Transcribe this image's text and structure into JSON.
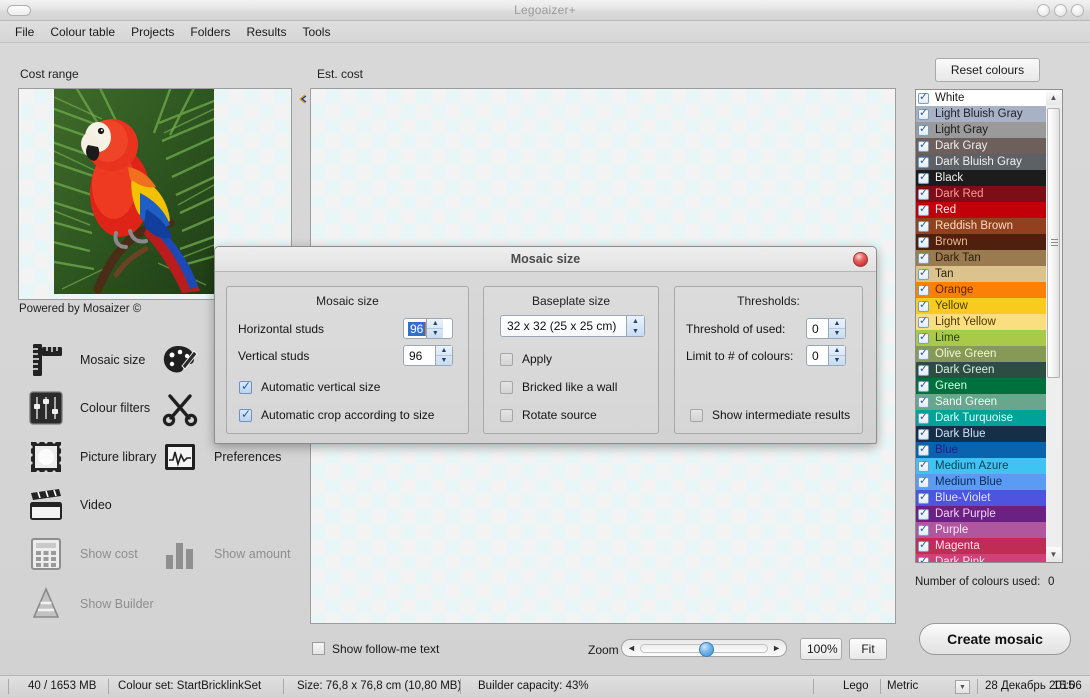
{
  "window": {
    "title": "Legoaizer+",
    "controls": [
      "minimize",
      "maximize",
      "close"
    ]
  },
  "menubar": {
    "items": [
      "File",
      "Colour table",
      "Projects",
      "Folders",
      "Results",
      "Tools"
    ]
  },
  "panels": {
    "cost_range_label": "Cost range",
    "est_cost_label": "Est. cost",
    "powered_by": "Powered by Mosaizer ©",
    "collapse_arrow": "«"
  },
  "tools": [
    {
      "label": "Mosaic size",
      "icon": "ruler-icon",
      "disabled": false
    },
    {
      "label": "Colour filters",
      "icon": "sliders-icon",
      "disabled": false
    },
    {
      "label": "Picture library",
      "icon": "stamp-frame-icon",
      "disabled": false
    },
    {
      "label": "Video",
      "icon": "clapperboard-icon",
      "disabled": false
    },
    {
      "label": "Show cost",
      "icon": "calculator-icon",
      "disabled": true
    },
    {
      "label": "Show Builder",
      "icon": "traffic-cone-icon",
      "disabled": true
    },
    {
      "label": "",
      "icon": "palette-brush-icon",
      "disabled": false
    },
    {
      "label": "",
      "icon": "scissors-icon",
      "disabled": false
    },
    {
      "label": "Preferences",
      "icon": "waveform-monitor-icon",
      "disabled": false
    },
    {
      "label": "Show amount",
      "icon": "bar-chart-icon",
      "disabled": true
    }
  ],
  "colour_panel": {
    "reset_label": "Reset colours",
    "colours_used_label": "Number of colours used:",
    "colours_used_value": "0",
    "create_mosaic_label": "Create mosaic",
    "colours": [
      {
        "name": "White",
        "swatch": "#ffffff",
        "text": "#1a1a1a",
        "checked": true
      },
      {
        "name": "Light Bluish Gray",
        "swatch": "#a9b1c4",
        "text": "#1e2230",
        "checked": true
      },
      {
        "name": "Light Gray",
        "swatch": "#9a9a9a",
        "text": "#1a1a1a",
        "checked": true
      },
      {
        "name": "Dark Gray",
        "swatch": "#6d5f5c",
        "text": "#efefef",
        "checked": true
      },
      {
        "name": "Dark Bluish Gray",
        "swatch": "#5d6166",
        "text": "#f0f0f0",
        "checked": true
      },
      {
        "name": "Black",
        "swatch": "#1d1c1c",
        "text": "#f2f2f2",
        "checked": true
      },
      {
        "name": "Dark Red",
        "swatch": "#7b0e16",
        "text": "#ff9a9a",
        "checked": true
      },
      {
        "name": "Red",
        "swatch": "#c20009",
        "text": "#ffe9e9",
        "checked": true
      },
      {
        "name": "Reddish Brown",
        "swatch": "#92401f",
        "text": "#ffd9c2",
        "checked": true
      },
      {
        "name": "Brown",
        "swatch": "#50200f",
        "text": "#e8b894",
        "checked": true
      },
      {
        "name": "Dark Tan",
        "swatch": "#9a7b4f",
        "text": "#2a1d0c",
        "checked": true
      },
      {
        "name": "Tan",
        "swatch": "#dcc38d",
        "text": "#2b2310",
        "checked": true
      },
      {
        "name": "Orange",
        "swatch": "#fb8008",
        "text": "#5a2500",
        "checked": true
      },
      {
        "name": "Yellow",
        "swatch": "#f9cb1f",
        "text": "#4d3c00",
        "checked": true
      },
      {
        "name": "Light Yellow",
        "swatch": "#fbde7e",
        "text": "#4a3a00",
        "checked": true
      },
      {
        "name": "Lime",
        "swatch": "#a9ca48",
        "text": "#2e3d0b",
        "checked": true
      },
      {
        "name": "Olive Green",
        "swatch": "#879a55",
        "text": "#f2f6e3",
        "checked": true
      },
      {
        "name": "Dark Green",
        "swatch": "#2d4d42",
        "text": "#d8f0e3",
        "checked": true
      },
      {
        "name": "Green",
        "swatch": "#00703c",
        "text": "#d9ffe7",
        "checked": true
      },
      {
        "name": "Sand Green",
        "swatch": "#69a68b",
        "text": "#f0fbf5",
        "checked": true
      },
      {
        "name": "Dark Turquoise",
        "swatch": "#00a199",
        "text": "#ddfffb",
        "checked": true
      },
      {
        "name": "Dark Blue",
        "swatch": "#152f47",
        "text": "#cfe3f5",
        "checked": true
      },
      {
        "name": "Blue",
        "swatch": "#0a64ad",
        "text": "#2b1a8a",
        "checked": true
      },
      {
        "name": "Medium Azure",
        "swatch": "#3fc3f2",
        "text": "#11405a",
        "checked": true
      },
      {
        "name": "Medium Blue",
        "swatch": "#5a9bf3",
        "text": "#0f2a55",
        "checked": true
      },
      {
        "name": "Blue-Violet",
        "swatch": "#4e53e0",
        "text": "#dfe2ff",
        "checked": true
      },
      {
        "name": "Dark Purple",
        "swatch": "#6b2084",
        "text": "#f0d5fa",
        "checked": true
      },
      {
        "name": "Purple",
        "swatch": "#b0569f",
        "text": "#fde6f8",
        "checked": true
      },
      {
        "name": "Magenta",
        "swatch": "#bf2c55",
        "text": "#ffe0e8",
        "checked": true
      },
      {
        "name": "Dark Pink",
        "swatch": "#d0417a",
        "text": "#ffe6f0",
        "checked": true
      }
    ]
  },
  "bottom_bar": {
    "show_followme_label": "Show follow-me text",
    "show_followme_checked": false,
    "zoom_label": "Zoom",
    "zoom_value": "100%",
    "fit_label": "Fit",
    "zoom_left_arrow": "◄",
    "zoom_right_arrow": "►"
  },
  "statusbar": {
    "memory": "40 / 1653 MB",
    "colour_set": "Colour set: StartBricklinkSet",
    "size": "Size: 76,8 x 76,8 cm (10,80 MB)",
    "builder_capacity": "Builder capacity: 43%",
    "brand": "Lego",
    "units": "Metric",
    "date": "28 Декабрь 2015",
    "time": "15:06"
  },
  "dialog": {
    "title": "Mosaic size",
    "groups": {
      "mosaic_size": {
        "title": "Mosaic size",
        "horizontal_label": "Horizontal studs",
        "horizontal_value": "96",
        "vertical_label": "Vertical studs",
        "vertical_value": "96",
        "auto_vertical_label": "Automatic vertical size",
        "auto_vertical_checked": true,
        "auto_crop_label": "Automatic crop according to size",
        "auto_crop_checked": true
      },
      "baseplate_size": {
        "title": "Baseplate size",
        "selected": "32 x 32 (25 x 25 cm)",
        "apply_label": "Apply",
        "apply_checked": false,
        "bricked_label": "Bricked like a wall",
        "bricked_checked": false,
        "rotate_label": "Rotate source",
        "rotate_checked": false
      },
      "thresholds": {
        "title": "Thresholds:",
        "threshold_used_label": "Threshold of used:",
        "threshold_used_value": "0",
        "limit_colours_label": "Limit to # of colours:",
        "limit_colours_value": "0",
        "show_intermediate_label": "Show intermediate results",
        "show_intermediate_checked": false
      }
    }
  }
}
